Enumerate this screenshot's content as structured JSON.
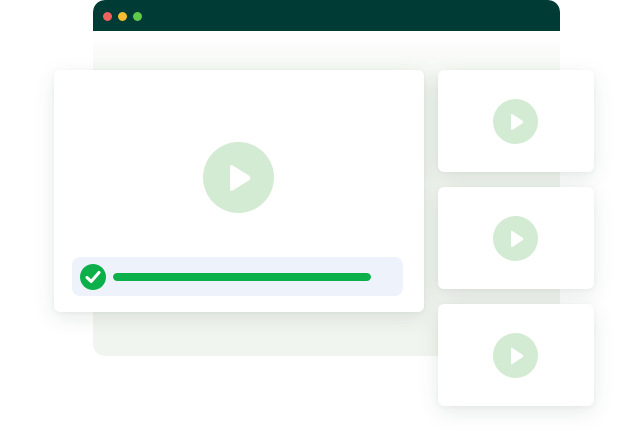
{
  "colors": {
    "titlebar": "#003b36",
    "window_body": "#f1f5ef",
    "dot_red": "#f0625c",
    "dot_yellow": "#f5bd2f",
    "dot_green": "#5fc94a",
    "play_circle": "#d4ebd3",
    "play_triangle": "#ffffff",
    "progress_bg": "#eef2fb",
    "progress_fill": "#0bb04b",
    "check_fill": "#0bb04b"
  },
  "browser": {
    "controls": [
      "close-dot",
      "minimize-dot",
      "maximize-dot"
    ]
  },
  "main_video": {
    "icon": "play-icon",
    "completed": true,
    "progress_fraction": 1.0
  },
  "thumbnails": [
    {
      "icon": "play-icon"
    },
    {
      "icon": "play-icon"
    },
    {
      "icon": "play-icon"
    }
  ]
}
